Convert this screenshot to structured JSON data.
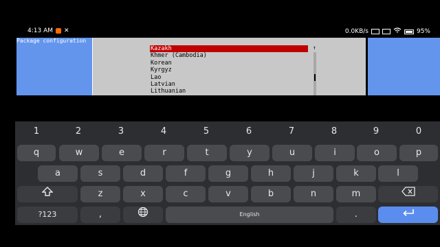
{
  "status_bar": {
    "time": "4:13 AM",
    "extra": "✕",
    "speed": "0.0KB/s",
    "battery": "95%"
  },
  "terminal": {
    "title": "Package configuration",
    "list_items": [
      "Kazakh",
      "Khmer (Cambodia)",
      "Korean",
      "Kyrgyz",
      "Lao",
      "Latvian",
      "Lithuanian"
    ],
    "selected_index": 0,
    "scroll_arrow": "↑"
  },
  "keyboard": {
    "numbers": [
      "1",
      "2",
      "3",
      "4",
      "5",
      "6",
      "7",
      "8",
      "9",
      "0"
    ],
    "row1": [
      "q",
      "w",
      "e",
      "r",
      "t",
      "y",
      "u",
      "i",
      "o",
      "p"
    ],
    "row2": [
      "a",
      "s",
      "d",
      "f",
      "g",
      "h",
      "j",
      "k",
      "l"
    ],
    "row3": [
      "z",
      "x",
      "c",
      "v",
      "b",
      "n",
      "m"
    ],
    "symbols_label": "?123",
    "comma": ",",
    "space_label": "English",
    "period": "."
  }
}
